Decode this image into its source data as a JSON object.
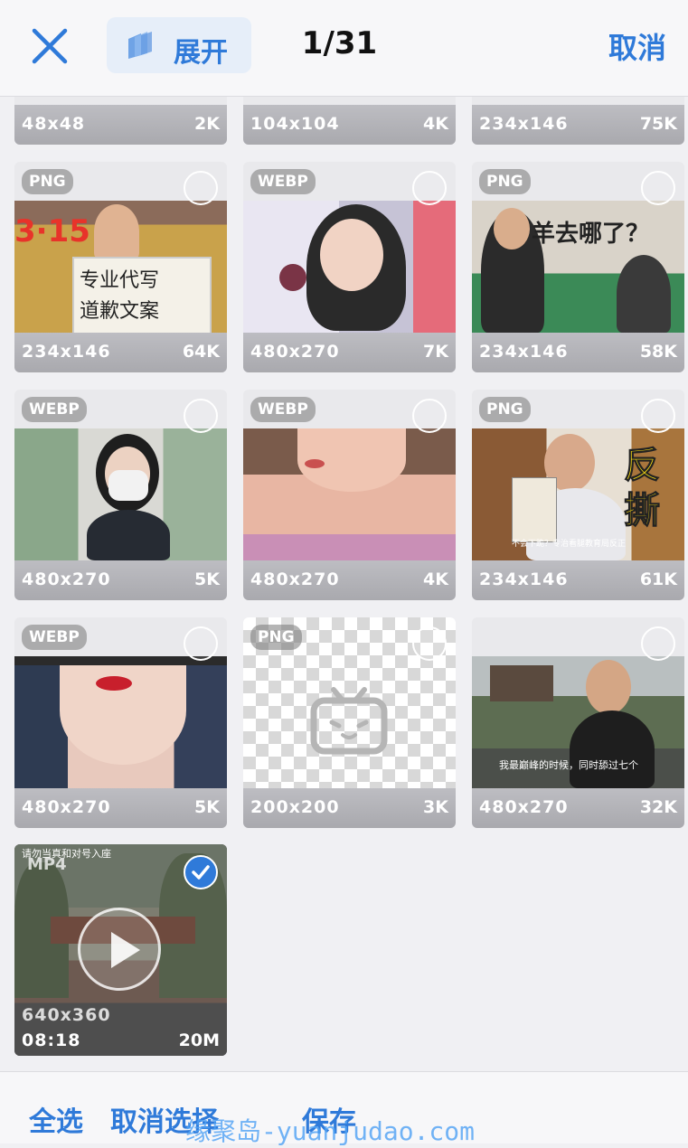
{
  "header": {
    "expand_label": "展开",
    "counter": "1/31",
    "cancel_label": "取消"
  },
  "top_row": [
    {
      "resolution": "48x48",
      "size": "2K"
    },
    {
      "resolution": "104x104",
      "size": "4K"
    },
    {
      "resolution": "234x146",
      "size": "75K"
    }
  ],
  "items": [
    {
      "format": "PNG",
      "resolution": "234x146",
      "size": "64K",
      "thumb_text": [
        "3·15",
        "专业代写",
        "道歉文案"
      ]
    },
    {
      "format": "WEBP",
      "resolution": "480x270",
      "size": "7K"
    },
    {
      "format": "PNG",
      "resolution": "234x146",
      "size": "58K",
      "thumb_text": [
        "羊去哪了？"
      ]
    },
    {
      "format": "WEBP",
      "resolution": "480x270",
      "size": "5K"
    },
    {
      "format": "WEBP",
      "resolution": "480x270",
      "size": "4K"
    },
    {
      "format": "PNG",
      "resolution": "234x146",
      "size": "61K",
      "thumb_text": [
        "反",
        "撕",
        "不会下跪？专治看腿教育局反正"
      ]
    },
    {
      "format": "WEBP",
      "resolution": "480x270",
      "size": "5K"
    },
    {
      "format": "PNG",
      "resolution": "200x200",
      "size": "3K"
    },
    {
      "format": "",
      "resolution": "480x270",
      "size": "32K",
      "thumb_text": [
        "我最巅峰的时候，同时舔过七个"
      ]
    }
  ],
  "video": {
    "caption": "请勿当真和对号入座",
    "format": "MP4",
    "resolution": "640x360",
    "duration": "08:18",
    "size": "20M",
    "selected": true
  },
  "footer": {
    "select_all": "全选",
    "deselect": "取消选择",
    "save": "保存"
  },
  "watermark": "缘聚岛-yuanjudao.com",
  "colors": {
    "accent": "#2f7ad9",
    "background": "#f0f0f3"
  }
}
